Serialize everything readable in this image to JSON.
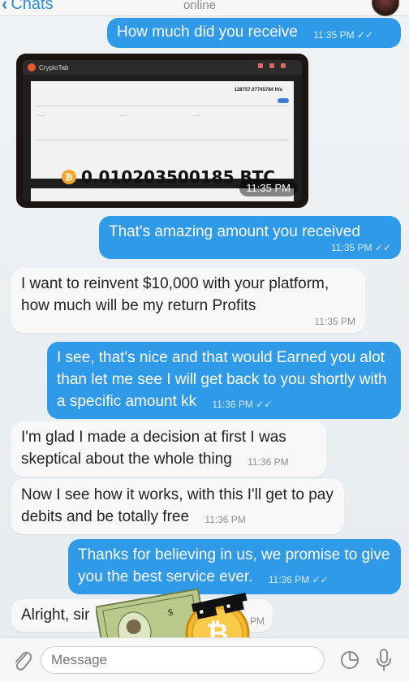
{
  "header": {
    "back_label": "Chats",
    "status": "online"
  },
  "messages": [
    {
      "text": "How much did you receive",
      "time": "11:35 PM"
    },
    {
      "image": {
        "app_name": "CryptoTab",
        "rate": "128757.07745784 H/s",
        "balance": "0.010203500185 BTC",
        "time": "11:35 PM"
      }
    },
    {
      "text": "That's amazing amount you received",
      "time": "11:35 PM"
    },
    {
      "text": "I want to reinvent $10,000 with your platform, how much will be my return Profits",
      "time": "11:35 PM"
    },
    {
      "text": "I see, that's nice and that would Earned you alot than let me see I will get back to you shortly with a specific amount kk",
      "time": "11:36 PM"
    },
    {
      "text": "I'm glad I made a decision at first I was skeptical about the whole thing",
      "time": "11:36 PM"
    },
    {
      "text": "Now I see how it works, with this I'll get to pay debits and be totally free",
      "time": "11:36 PM"
    },
    {
      "text": "Thanks for believing in us, we promise to give you the best service ever.",
      "time": "11:36 PM"
    },
    {
      "text": "Alright, sir",
      "time": "PM"
    }
  ],
  "input": {
    "placeholder": "Message"
  },
  "icons": {
    "attach": "paperclip-icon",
    "sticker": "sticker-icon",
    "mic": "microphone-icon",
    "read": "double-check-icon"
  },
  "colors": {
    "outgoing": "#2f9ae7",
    "incoming": "#f8f8f8",
    "accent": "#2e8bd8"
  }
}
